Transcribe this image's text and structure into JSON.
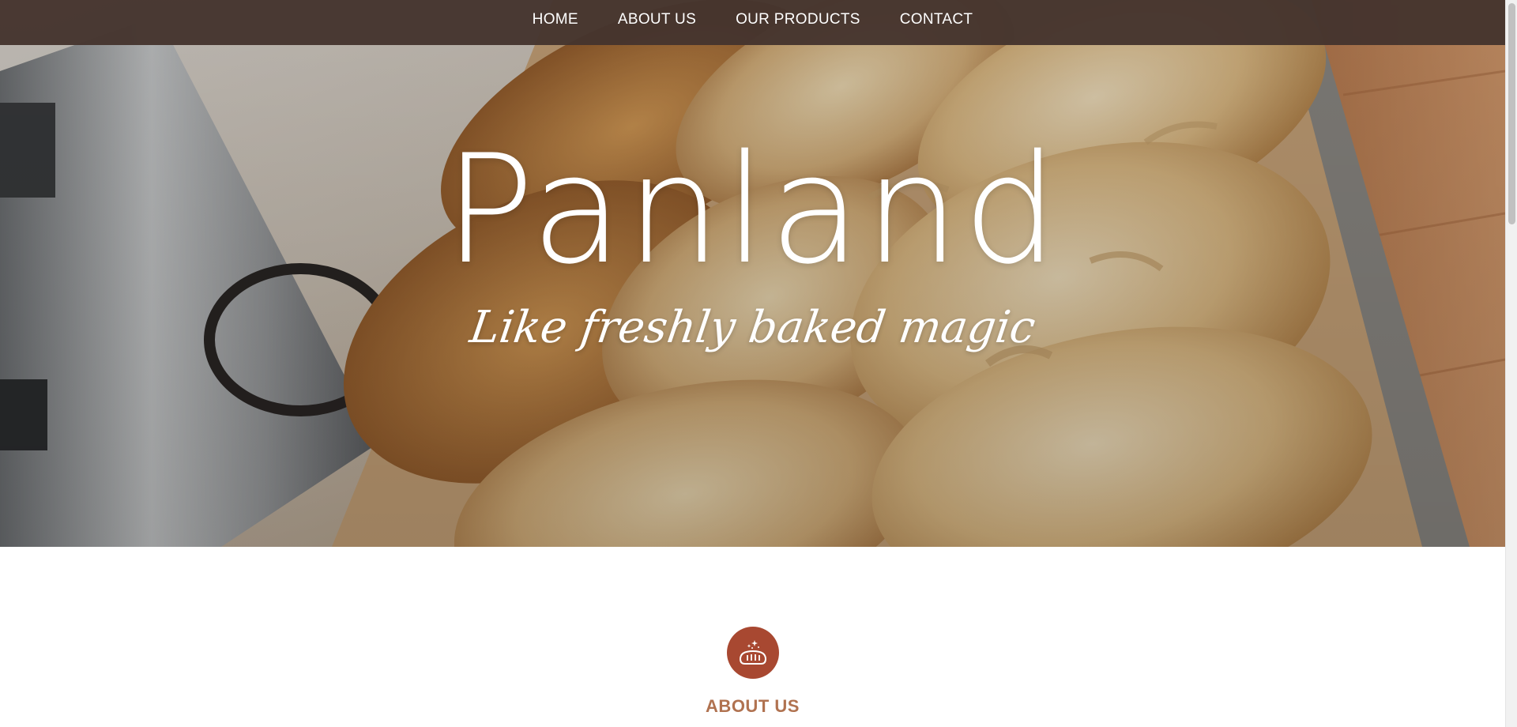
{
  "nav": {
    "items": [
      {
        "label": "HOME"
      },
      {
        "label": "ABOUT US"
      },
      {
        "label": "OUR PRODUCTS"
      },
      {
        "label": "CONTACT"
      }
    ]
  },
  "hero": {
    "title": "Panland",
    "tagline": "Like freshly baked magic",
    "image": "baked-bread-photo"
  },
  "about": {
    "icon": "bread-sparkle-icon",
    "heading": "ABOUT US"
  },
  "colors": {
    "nav_bg": "#45342e",
    "accent": "#a84831",
    "heading": "#b07250"
  }
}
